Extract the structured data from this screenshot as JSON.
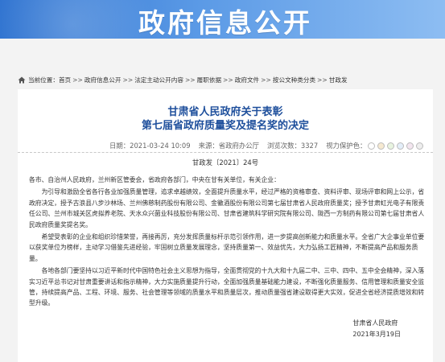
{
  "banner": {
    "title": "政府信息公开"
  },
  "breadcrumb": {
    "prefix": "当前位置：",
    "items": [
      "首页",
      "政府信息公开",
      "法定主动公开内容",
      "履职依据",
      "政府文件",
      "按公文种类分类",
      "甘政发"
    ],
    "separator": ">>"
  },
  "article": {
    "title_line1": "甘肃省人民政府关于表彰",
    "title_line2": "第七届省政府质量奖及提名奖的决定",
    "meta": {
      "date_label": "日期：",
      "date": "2021-03-24 10:09",
      "source_label": "来源：",
      "source": "省政府办公厅",
      "views_label": "浏览次数：",
      "views": "3327",
      "color_label": "视力保护色："
    },
    "protect_colors": [
      "#ffffff",
      "#f6e9d1",
      "#e8f4e0",
      "#e3eef9",
      "#f3e5ef",
      "#eeeeee"
    ],
    "doc_number": "甘政发〔2021〕24号",
    "salutation": "各市、自治州人民政府，兰州新区管委会，省政府各部门，中央在甘有关单位，有关企业：",
    "paragraphs": [
      "为引导和激励全省各行各业加强质量管理，追求卓越绩效，全面提升质量水平，经过严格的资格审查、资料评审、现场评审和网上公示，省政府决定，授予古浪县八步沙林场、兰州佛慈制药股份有限公司、金徽酒股份有限公司第七届甘肃省人民政府质量奖；授予甘肃虹光电子有限责任公司、兰州市城关区虎拟养老院、天水众兴菌业科技股份有限公司、甘肃省建筑科学研究院有限公司、陇西一方制药有限公司第七届甘肃省人民政府质量奖提名奖。",
      "希望受表彰的企业和组织珍惜荣誉，再接再厉，充分发挥质量标杆示范引领作用，进一步提高创新能力和质量水平。全省广大企事业单位要以获奖单位为榜样，主动学习借鉴先进经验，牢固树立质量发展理念，坚持质量第一、效益优先，大力弘扬工匠精神，不断提高产品和服务质量。",
      "各地各部门要坚持以习近平新时代中国特色社会主义思想为指导，全面贯彻党的十九大和十九届二中、三中、四中、五中全会精神，深入落实习近平总书记对甘肃重要讲话和指示精神，大力实施质量提升行动，全面加强质量基础能力建设，不断强化质量服务、信用管理和质量安全监管，持续提高产品、工程、环境、服务、社会管理等领域的质量水平和质量层次，推动质量强省建设取得更大实效，促进全省经济提质增效和转型升级。"
    ],
    "signature": "甘肃省人民政府",
    "sign_date": "2021年3月19日"
  }
}
